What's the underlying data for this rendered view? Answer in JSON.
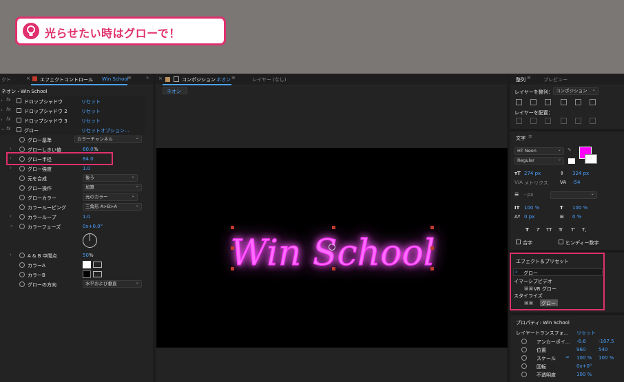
{
  "banner": {
    "text": "光らせたい時はグローで！"
  },
  "effect_panel": {
    "tab_left": "クト",
    "tab_title": "エフェクトコントロール",
    "tab_layer": "Win School",
    "breadcrumb": "ネオン・Win School",
    "effects": [
      {
        "name": "ドロップシャドウ",
        "reset": "リセット"
      },
      {
        "name": "ドロップシャドウ 2",
        "reset": "リセット"
      },
      {
        "name": "ドロップシャドウ 3",
        "reset": "リセット"
      },
      {
        "name": "グロー",
        "reset": "リセット",
        "options": "オプション..."
      }
    ],
    "props": [
      {
        "label": "グロー基準",
        "dropdown": "カラーチャンネル"
      },
      {
        "label": "グローしきい値",
        "value": "60.0",
        "unit": "%"
      },
      {
        "label": "グロー半径",
        "value": "84.0"
      },
      {
        "label": "グロー強度",
        "value": "1.0"
      },
      {
        "label": "元を合成",
        "dropdown": "後ろ"
      },
      {
        "label": "グロー操作",
        "dropdown": "加算"
      },
      {
        "label": "グローカラー",
        "dropdown": "元のカラー"
      },
      {
        "label": "カラールーピング",
        "dropdown": "三角形 A>B>A"
      },
      {
        "label": "カラーループ",
        "value": "1.0"
      },
      {
        "label": "カラーフェーズ",
        "value": "0x+0.0°"
      },
      {
        "label": "A & B 中間点",
        "value": "50",
        "unit": "%"
      },
      {
        "label": "カラーA"
      },
      {
        "label": "カラーB"
      },
      {
        "label": "グローの方向",
        "dropdown": "水平および垂直"
      }
    ]
  },
  "comp_panel": {
    "tab_title": "コンポジション",
    "tab_name": "ネオン",
    "layer_tab": "レイヤー (なし)",
    "subtab": "ネオン",
    "neon_text": "Win School"
  },
  "right_panel": {
    "align_tab": "整列",
    "preview_tab": "プレビュー",
    "align_to_label": "レイヤーを整列：",
    "align_to_value": "コンポジション",
    "distribute_label": "レイヤーを配置：",
    "text_tab": "文字",
    "font_name": "HT Neon",
    "font_style": "Regular",
    "font_size": "274 px",
    "leading": "324 px",
    "kerning": "メトリクス",
    "tracking": "-54",
    "stroke_width": "- px",
    "vscale": "100 %",
    "hscale": "100 %",
    "baseline": "0 px",
    "tsume": "0 %",
    "text_styles": [
      "T",
      "T",
      "TT",
      "Tr",
      "T'",
      "T,"
    ],
    "ligature": "合字",
    "hindi": "ヒンディー数字",
    "effects_tab": "エフェクト＆プリセット",
    "search_value": "グロー",
    "categories": [
      {
        "name": "イマーシブビデオ",
        "item": "VR グロー"
      },
      {
        "name": "スタイライズ",
        "item": "グロー"
      }
    ],
    "props_tab": "プロパティ: Win School",
    "layer_transform": "レイヤートランスフォ...",
    "transform_reset": "リセット",
    "transform": [
      {
        "label": "アンカーポイ...",
        "v1": "-6.6",
        "v2": "-107.5"
      },
      {
        "label": "位置",
        "v1": "960",
        "v2": "540"
      },
      {
        "label": "スケール",
        "v1": "100 %",
        "v2": "100 %"
      },
      {
        "label": "回転",
        "v1": "0x+0°"
      },
      {
        "label": "不透明度",
        "v1": "100 %"
      }
    ]
  },
  "colors": {
    "accent_pink": "#e0306e",
    "neon": "#ff3cff",
    "ae_blue": "#4aa2ff",
    "fill_color": "#ff00ff"
  }
}
